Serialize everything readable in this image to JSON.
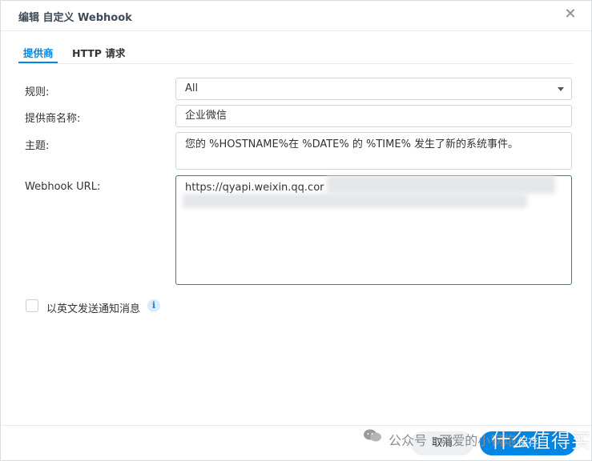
{
  "dialog": {
    "title": "编辑 自定义 Webhook"
  },
  "tabs": [
    {
      "label": "提供商"
    },
    {
      "label": "HTTP 请求"
    }
  ],
  "form": {
    "rule_label": "规则:",
    "rule_value": "All",
    "provider_label": "提供商名称:",
    "provider_value": "企业微信",
    "subject_label": "主题:",
    "subject_value": "您的 %HOSTNAME%在 %DATE% 的 %TIME% 发生了新的系统事件。",
    "url_label": "Webhook URL:",
    "url_value": "https://qyapi.weixin.qq.cor"
  },
  "options": {
    "english_label": "以英文发送通知消息",
    "info_icon": "i"
  },
  "footer": {
    "cancel_label": "取消",
    "save_label": "保存"
  },
  "watermark": {
    "channel": "公众号 · 可爱的小钢炮",
    "brand": "什么值得买"
  }
}
